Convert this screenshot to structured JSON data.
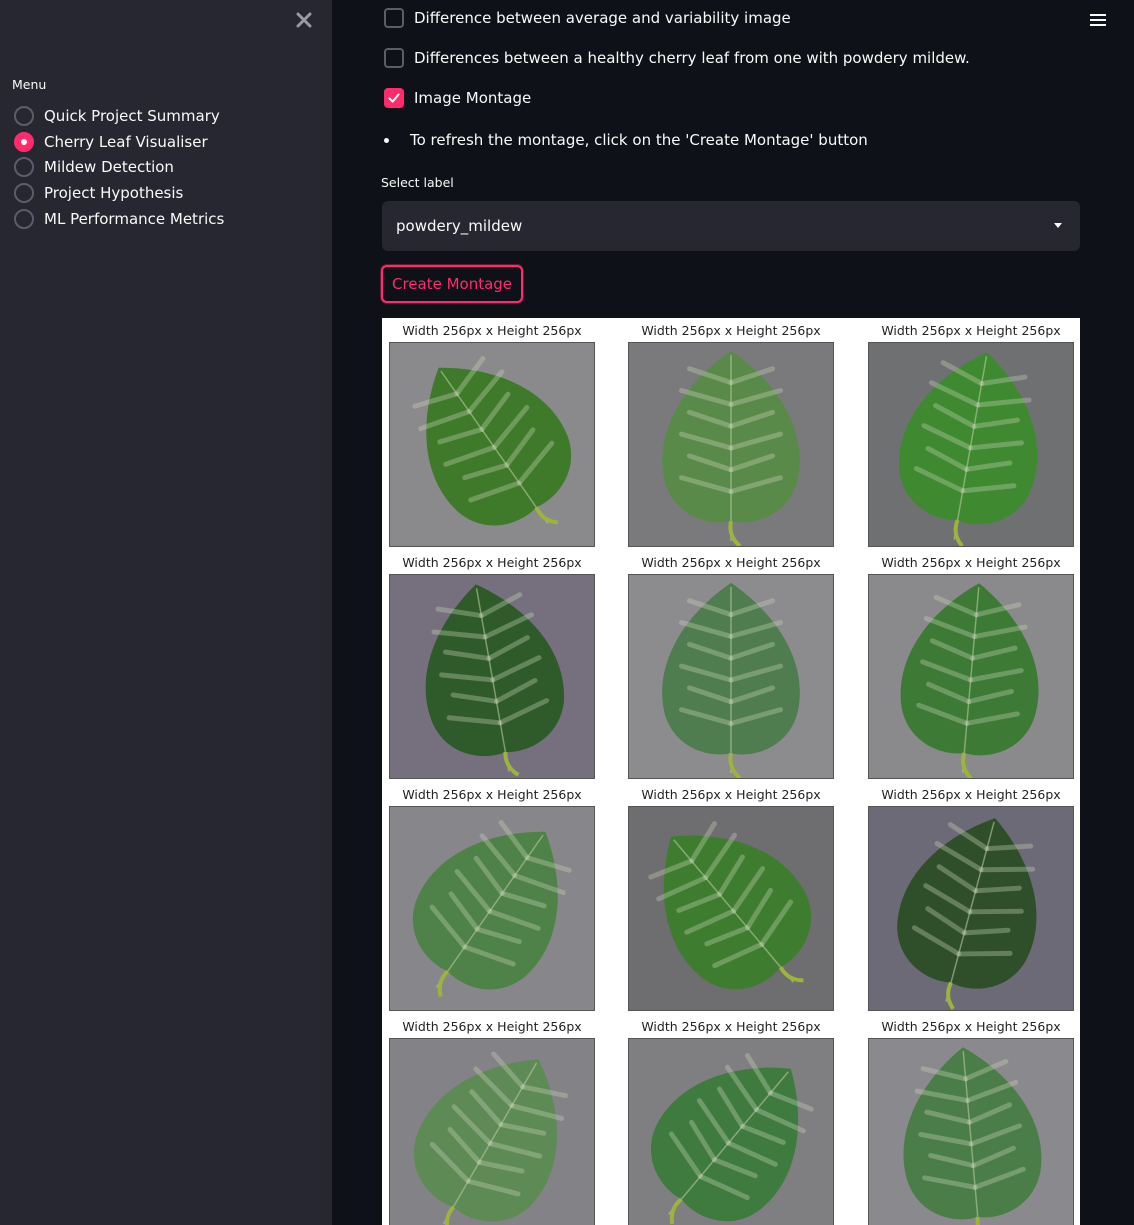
{
  "sidebar": {
    "close_icon": "close-icon",
    "menu_label": "Menu",
    "items": [
      {
        "label": "Quick Project Summary",
        "selected": false
      },
      {
        "label": "Cherry Leaf Visualiser",
        "selected": true
      },
      {
        "label": "Mildew Detection",
        "selected": false
      },
      {
        "label": "Project Hypothesis",
        "selected": false
      },
      {
        "label": "ML Performance Metrics",
        "selected": false
      }
    ]
  },
  "header": {
    "menu_icon": "hamburger-icon"
  },
  "checkboxes": [
    {
      "label": "Difference between average and variability image",
      "checked": false
    },
    {
      "label": "Differences between a healthy cherry leaf from one with powdery mildew.",
      "checked": false
    },
    {
      "label": "Image Montage",
      "checked": true
    }
  ],
  "bullet": {
    "text": "To refresh the montage, click on the 'Create Montage' button"
  },
  "select": {
    "label": "Select label",
    "value": "powdery_mildew"
  },
  "create_button": {
    "label": "Create Montage"
  },
  "montage": {
    "caption": "Width 256px x Height 256px",
    "rows": 4,
    "cols": 3
  },
  "colors": {
    "accent": "#ff2b6b",
    "sidebar_bg": "#262730",
    "main_bg": "#0e1117"
  }
}
